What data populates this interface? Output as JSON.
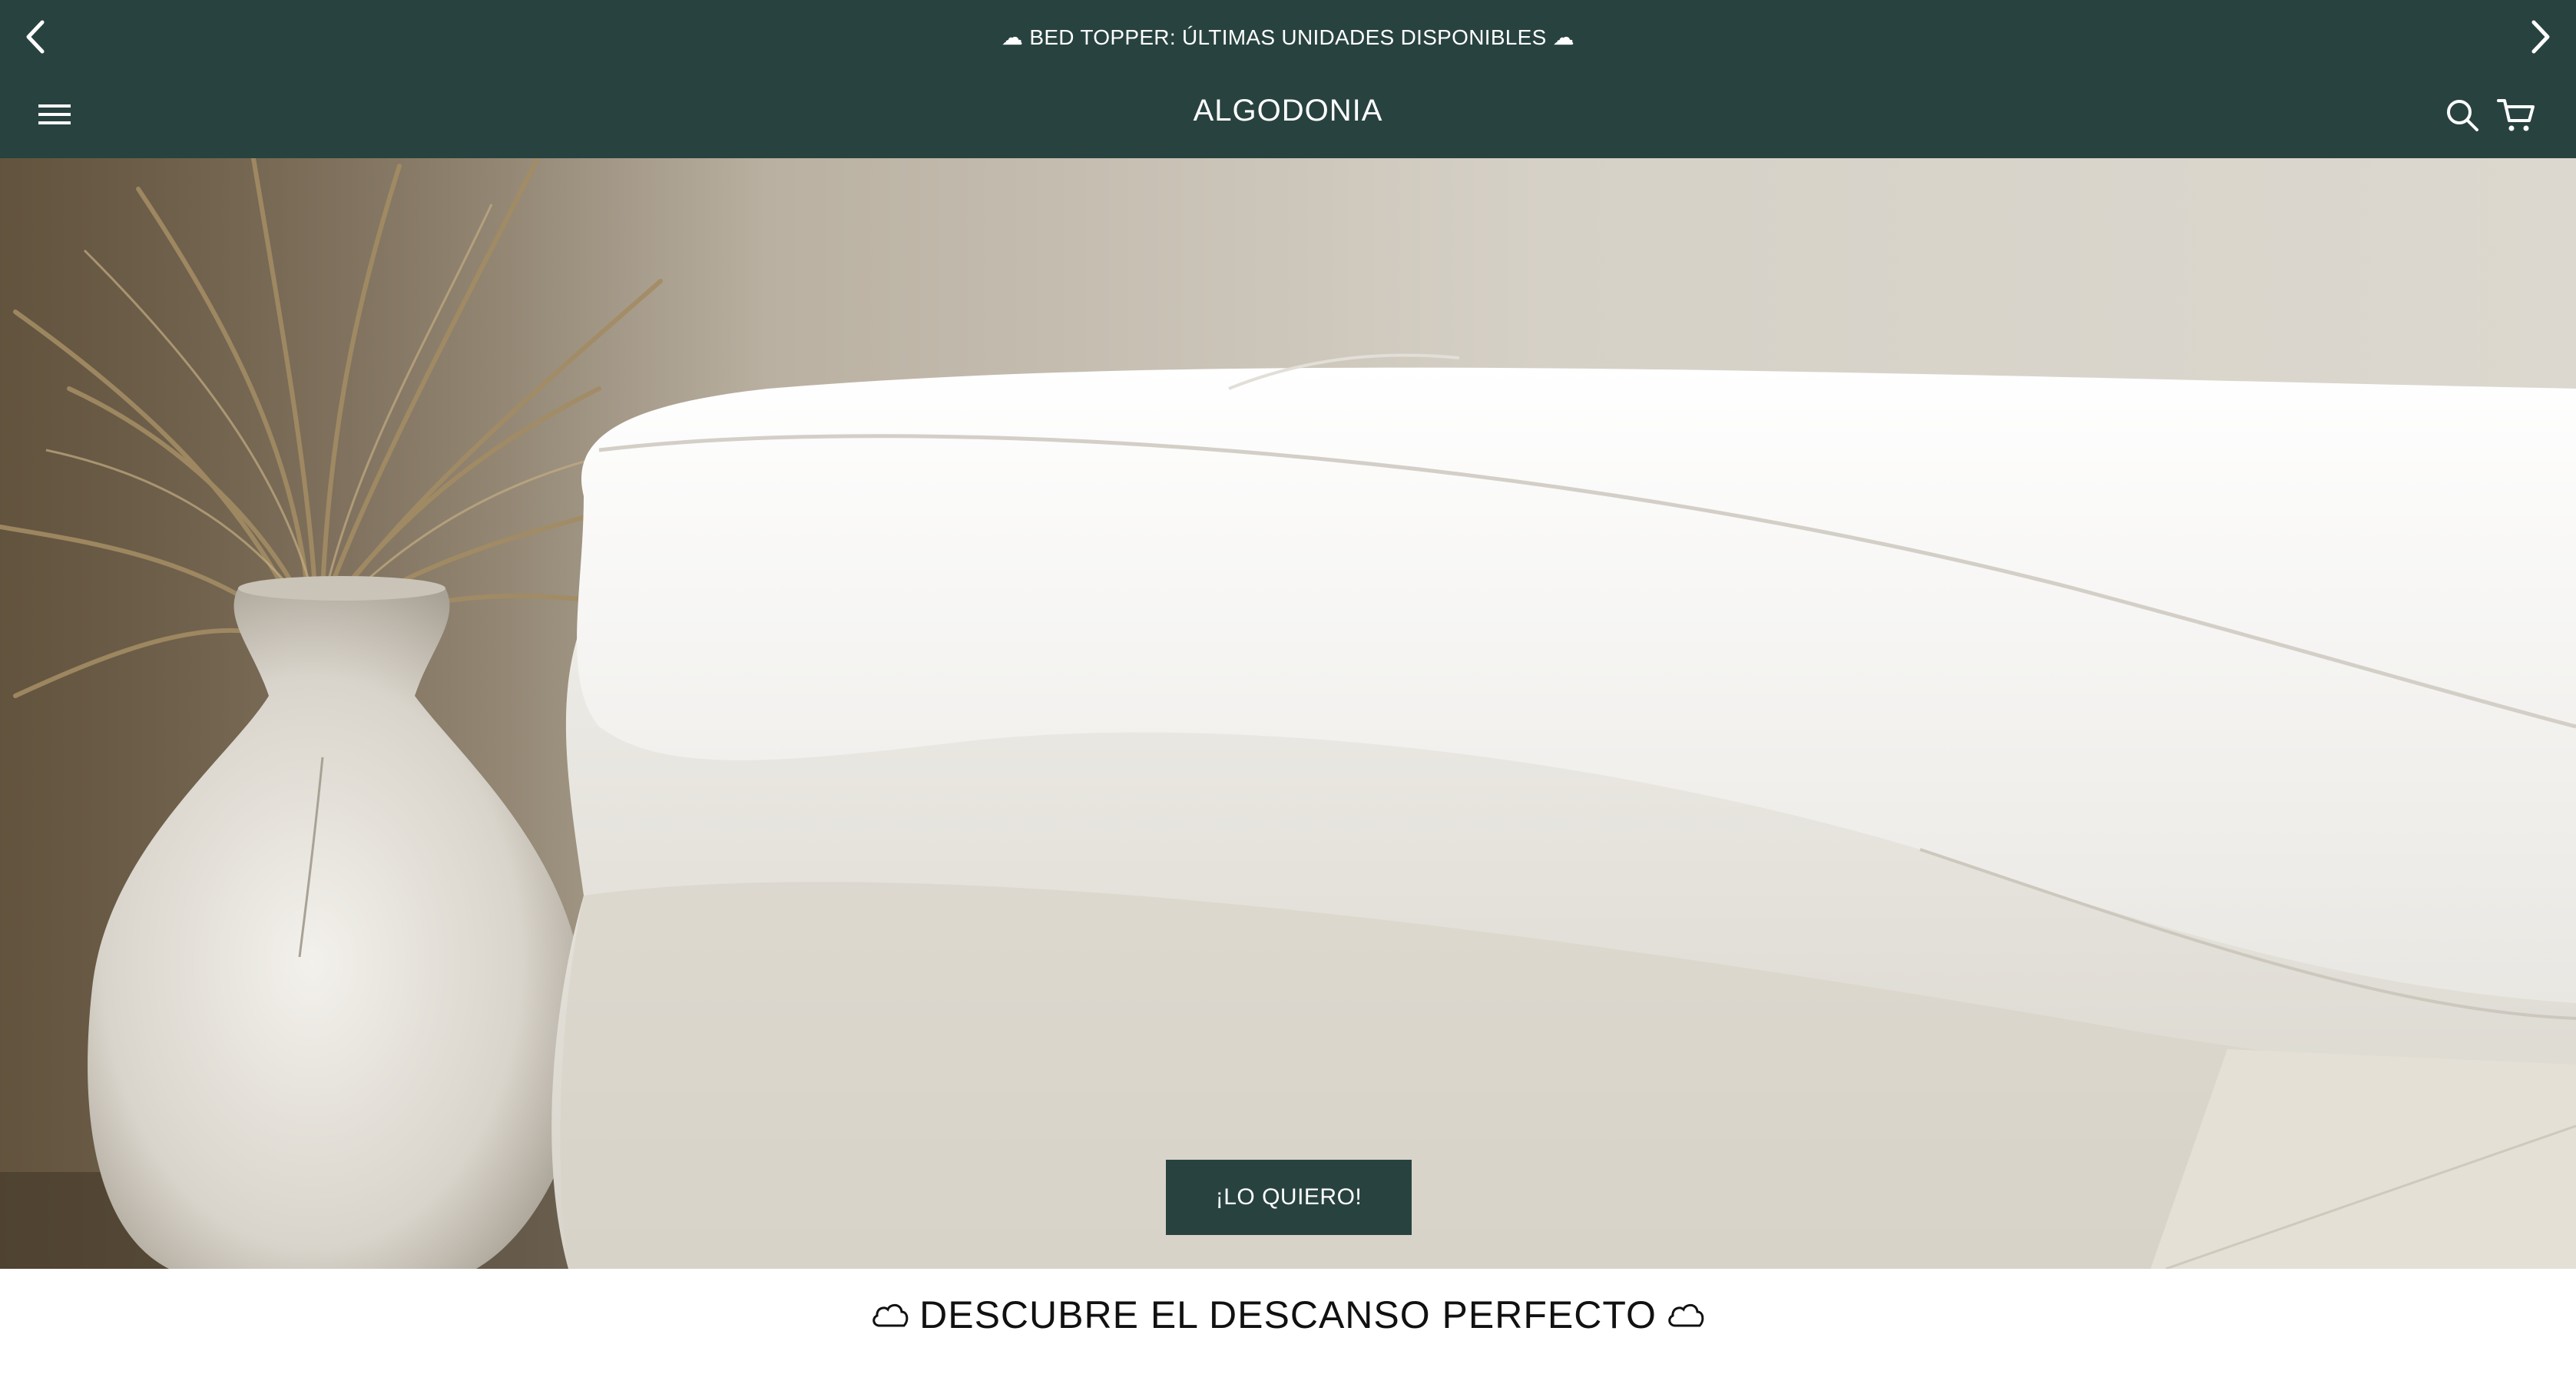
{
  "announcement": {
    "text": "☁ BED TOPPER: ÚLTIMAS UNIDADES DISPONIBLES ☁",
    "prev_icon": "chevron-left-icon",
    "next_icon": "chevron-right-icon"
  },
  "header": {
    "logo": "ALGODONIA",
    "menu_icon": "hamburger-menu-icon",
    "search_icon": "search-icon",
    "cart_icon": "cart-icon"
  },
  "hero": {
    "image": "bed topper on mattress next to vase with pampas grass",
    "cta_label": "¡LO QUIERO!"
  },
  "section": {
    "title": "DESCUBRE EL DESCANSO PERFECTO",
    "icon": "cloud-icon"
  },
  "colors": {
    "brand": "#28433f",
    "text_light": "#ffffff",
    "text_dark": "#111111"
  }
}
